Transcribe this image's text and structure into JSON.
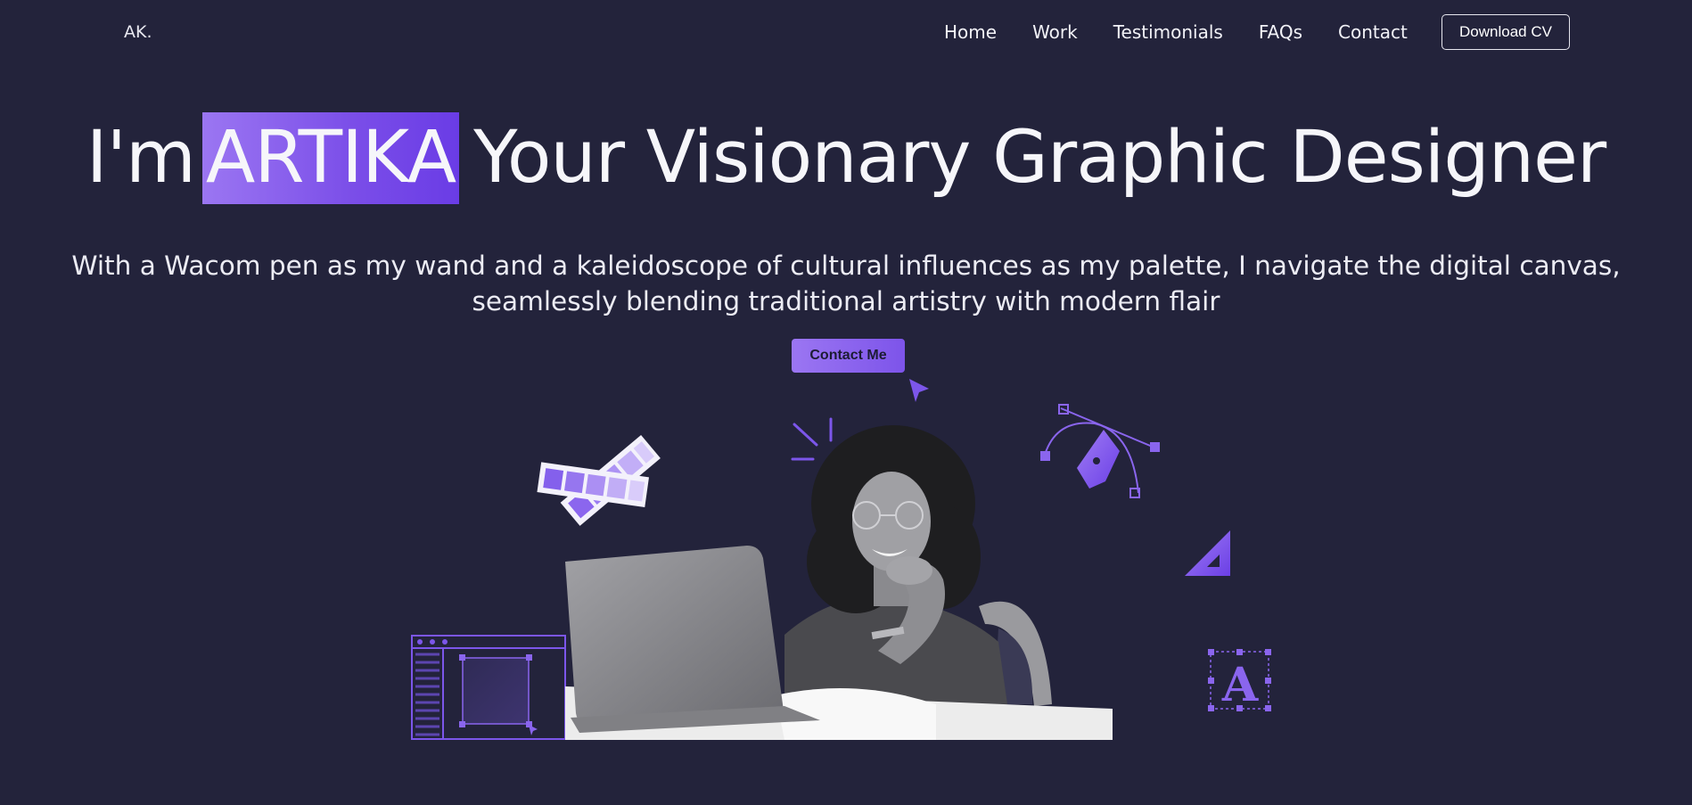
{
  "nav": {
    "logo": "AK.",
    "links": [
      "Home",
      "Work",
      "Testimonials",
      "FAQs",
      "Contact"
    ],
    "cta": "Download CV"
  },
  "hero": {
    "title_prefix": "I'm",
    "title_highlight": "ARTIKA",
    "title_suffix": "Your Visionary Graphic Designer",
    "subtitle_line1": "With a Wacom pen as my wand and a kaleidoscope of cultural influences as my palette, I navigate the digital canvas,",
    "subtitle_line2": "seamlessly blending traditional artistry with modern flair",
    "cta": "Contact Me",
    "type_glyph": "A"
  },
  "colors": {
    "background": "#23233b",
    "accent": "#8a60f0",
    "accent_dark": "#6a3ce6",
    "text": "#ffffff"
  },
  "icons": [
    "color-swatch-icon",
    "cursor-arrow-icon",
    "pen-tool-icon",
    "set-square-icon",
    "text-type-icon",
    "design-window-icon",
    "sparkle-lines-icon"
  ]
}
